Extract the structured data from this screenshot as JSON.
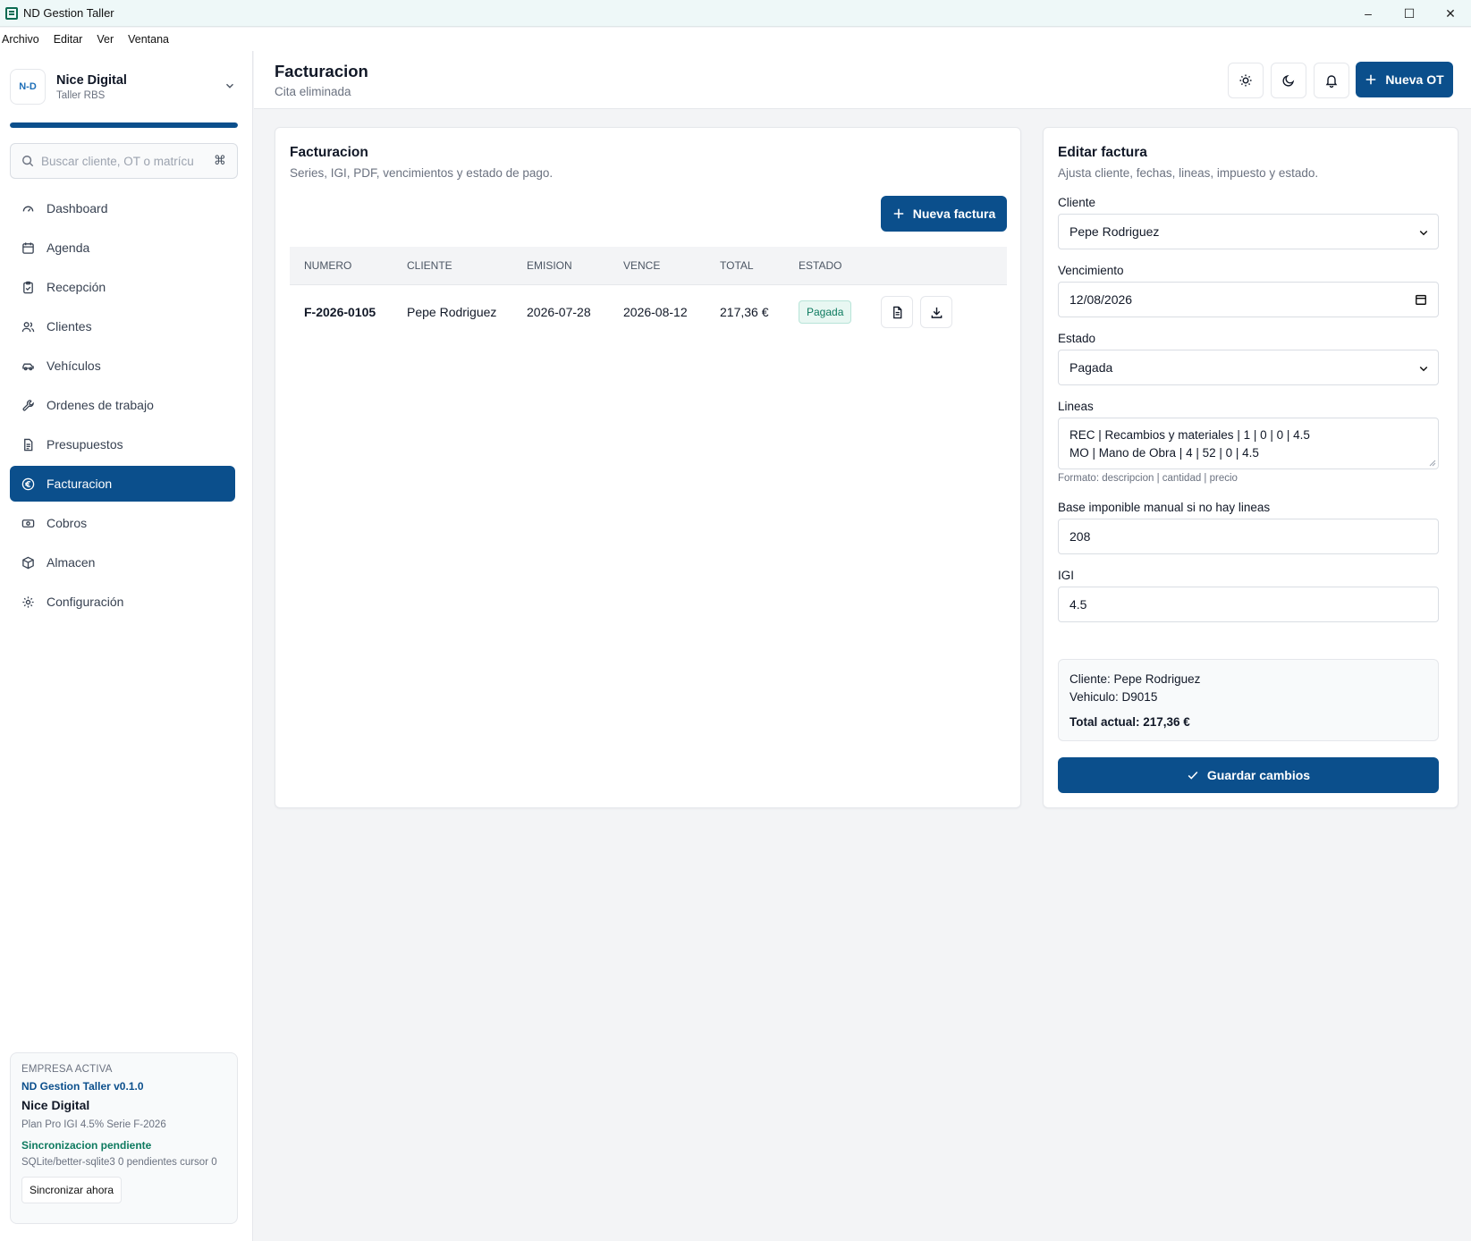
{
  "window": {
    "title": "ND Gestion Taller",
    "controls": [
      "–",
      "☐",
      "✕"
    ]
  },
  "menu": [
    "Archivo",
    "Editar",
    "Ver",
    "Ventana"
  ],
  "sidebar": {
    "brand": {
      "logo": "N-D",
      "name": "Nice Digital",
      "sub": "Taller RBS"
    },
    "progress": 1.0,
    "search_placeholder": "Buscar cliente, OT o matrícula",
    "search_kbd": "⌘",
    "items": [
      {
        "label": "Dashboard",
        "icon": "gauge-icon"
      },
      {
        "label": "Agenda",
        "icon": "calendar-icon"
      },
      {
        "label": "Recepción",
        "icon": "clipboard-icon"
      },
      {
        "label": "Clientes",
        "icon": "users-icon"
      },
      {
        "label": "Vehículos",
        "icon": "car-icon"
      },
      {
        "label": "Ordenes de trabajo",
        "icon": "wrench-icon"
      },
      {
        "label": "Presupuestos",
        "icon": "document-icon"
      },
      {
        "label": "Facturacion",
        "icon": "euro-icon",
        "active": true
      },
      {
        "label": "Cobros",
        "icon": "banknote-icon"
      },
      {
        "label": "Almacen",
        "icon": "package-icon"
      },
      {
        "label": "Configuración",
        "icon": "gear-icon"
      }
    ],
    "company": {
      "label": "EMPRESA ACTIVA",
      "version": "ND Gestion Taller v0.1.0",
      "name": "Nice Digital",
      "plan": "Plan Pro IGI 4.5% Serie F-2026",
      "sync_status": "Sincronizacion pendiente",
      "db": "SQLite/better-sqlite3 0 pendientes cursor 0",
      "sync_button": "Sincronizar ahora"
    }
  },
  "header": {
    "title": "Facturacion",
    "subtitle": "Cita eliminada",
    "new_ot": "Nueva OT"
  },
  "list": {
    "title": "Facturacion",
    "subtitle": "Series, IGI, PDF, vencimientos y estado de pago.",
    "new_button": "Nueva factura",
    "columns": [
      "NUMERO",
      "CLIENTE",
      "EMISION",
      "VENCE",
      "TOTAL",
      "ESTADO",
      ""
    ],
    "rows": [
      {
        "numero": "F-2026-0105",
        "cliente": "Pepe Rodriguez",
        "emision": "2026-07-28",
        "vence": "2026-08-12",
        "total": "217,36 €",
        "estado": "Pagada"
      }
    ]
  },
  "edit": {
    "title": "Editar factura",
    "subtitle": "Ajusta cliente, fechas, lineas, impuesto y estado.",
    "cliente_label": "Cliente",
    "cliente_value": "Pepe Rodriguez",
    "vencimiento_label": "Vencimiento",
    "vencimiento_value": "12/08/2026",
    "estado_label": "Estado",
    "estado_value": "Pagada",
    "lineas_label": "Lineas",
    "lineas": [
      "REC | Recambios y materiales | 1 | 0 | 0 | 4.5",
      "MO | Mano de Obra | 4 | 52 | 0 | 4.5"
    ],
    "lineas_hint": "Formato: descripcion | cantidad | precio",
    "base_label": "Base imponible manual si no hay lineas",
    "base_value": "208",
    "igi_label": "IGI",
    "igi_value": "4.5",
    "summary": {
      "cliente": "Cliente: Pepe Rodriguez",
      "vehiculo": "Vehiculo: D9015",
      "total": "Total actual: 217,36 €"
    },
    "save_button": "Guardar cambios"
  },
  "colors": {
    "primary": "#0b4f8c",
    "success": "#0d7a5f",
    "badge_bg": "#e8f7f2"
  }
}
